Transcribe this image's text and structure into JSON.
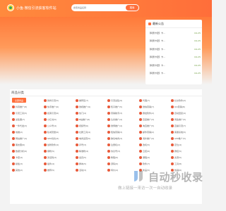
{
  "header": {
    "site_name": "小鱼·微信引流获客软件站",
    "search_placeholder": "搜索商品名称",
    "search_button": "搜索"
  },
  "notice": {
    "title": "最新公告",
    "items": [
      {
        "text": "【特惠卡密】卡...",
        "date": "04-25"
      },
      {
        "text": "【特惠卡密】卡...",
        "date": "04-25"
      },
      {
        "text": "【特惠卡密】卡...",
        "date": "04-25"
      },
      {
        "text": "【特惠卡密】卡...",
        "date": "04-25"
      },
      {
        "text": "【特惠卡密】卡...",
        "date": "04-25"
      },
      {
        "text": "【特惠卡密】卡...",
        "date": "04-25"
      }
    ]
  },
  "categories": {
    "title": "商品分类",
    "active": "全部商品",
    "items": [
      "微商引流(5)",
      "推荐区(7)",
      "引流采集(9)",
      "代理(7)",
      "社交软件(2)",
      "抖音推广(8)",
      "快手推广(6)",
      "微视推广(9)",
      "知乎推广(5)",
      "微信营销(7)",
      "QQ营销(8)",
      "引流工具(5)",
      "拓客引流(6)",
      "热门(4)",
      "营销助手(3)",
      "群发软件(2)",
      "自动回复(4)",
      "采集器(7)",
      "小红书(5)",
      "B站推广(6)",
      "头条推广(4)",
      "百度推广(3)",
      "闲鱼推广(5)",
      "一件代发(3)",
      "公众号(4)",
      "视频号(6)",
      "微博推广(4)",
      "淘宝推广(5)",
      "直播引流(7)",
      "地推(2)",
      "私域流量(6)",
      "社群工具(4)",
      "短信营销(3)",
      "邮件营销(2)",
      "客服系统(5)",
      "网站推广(4)",
      "SEO优化(6)",
      "电商运营(5)",
      "跨境电商(3)",
      "海外推广(4)",
      "APP推广(5)",
      "朋友圈(6)",
      "加粉软件(4)",
      "养号(3)",
      "注册机(2)",
      "改机(5)",
      "定位(4)",
      "数据分析(6)",
      "爆粉(5)",
      "精准粉(4)",
      "协议号(3)",
      "云控(6)",
      "群控(5)",
      "卡密(4)",
      "激活码(3)",
      "会员(5)",
      "教程(6)",
      "课程(4)",
      "资源(5)",
      "模板(3)",
      "插件(4)",
      "脚本(5)",
      "源码(6)",
      "软件(7)",
      "工具(8)",
      "其他(2)",
      "推荐(5)",
      "活动(3)",
      "特价(4)",
      "新品(5)",
      "热销(6)"
    ]
  },
  "watermark": {
    "title": "自动秒收录",
    "subtitle": "做上链接一来访一次一自动收录"
  }
}
